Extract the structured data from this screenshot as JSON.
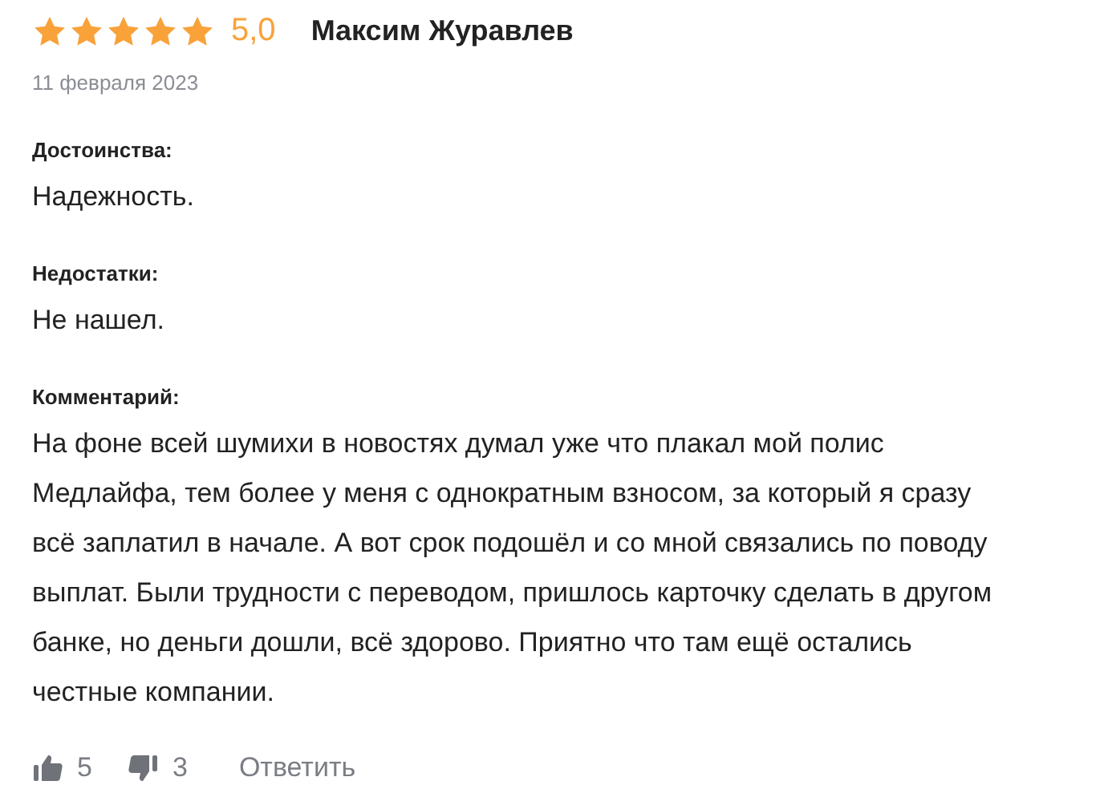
{
  "review": {
    "stars": 5,
    "rating": "5,0",
    "author": "Максим Журавлев",
    "date": "11 февраля 2023"
  },
  "sections": [
    {
      "label": "Достоинства:",
      "text": "Надежность."
    },
    {
      "label": "Недостатки:",
      "text": "Не нашел."
    },
    {
      "label": "Комментарий:",
      "text": "На фоне всей шумихи в новостях думал уже что плакал мой полис Медлайфа, тем более у меня с однократным взносом, за который я сразу всё заплатил в начале. А вот срок подошёл и со мной связались по поводу выплат. Были трудности с переводом, пришлось карточку сделать в другом банке, но деньги дошли, всё здорово. Приятно что там ещё остались честные компании."
    }
  ],
  "actions": {
    "likes": "5",
    "dislikes": "3",
    "reply": "Ответить"
  }
}
